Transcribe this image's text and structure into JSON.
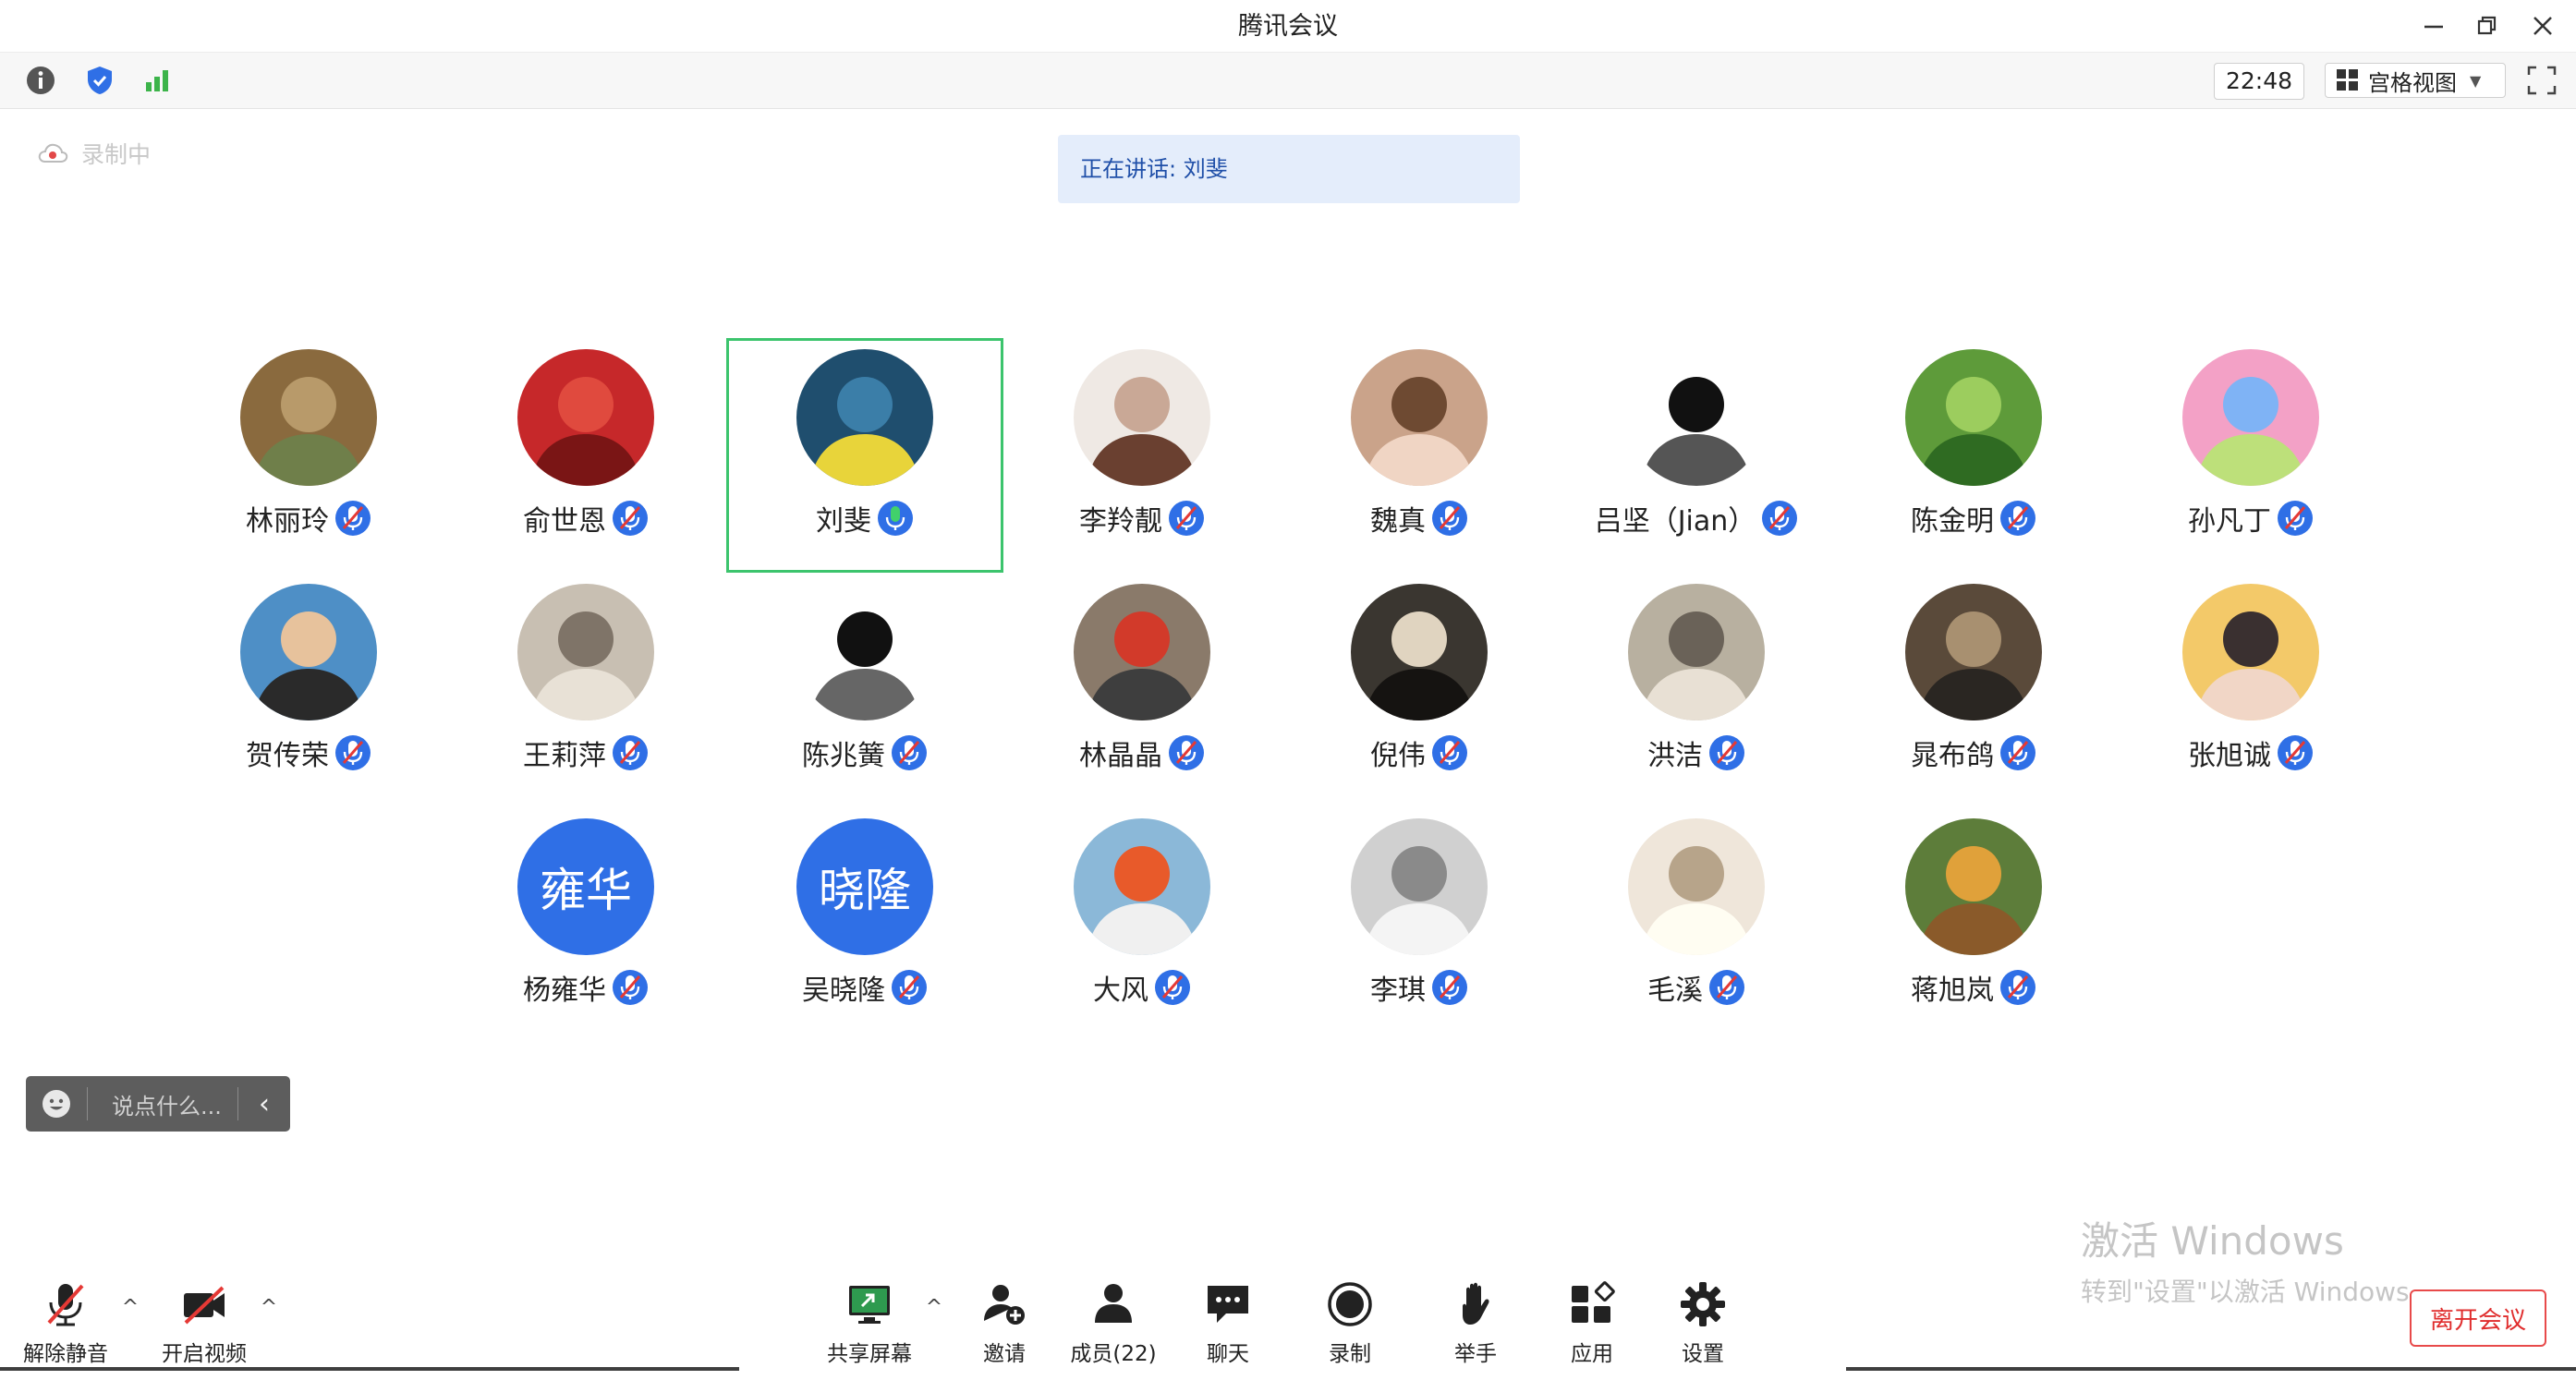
{
  "window": {
    "title": "腾讯会议"
  },
  "topbar": {
    "time": "22:48",
    "view_label": "宫格视图"
  },
  "recording": {
    "label": "录制中"
  },
  "speaking": {
    "label": "正在讲话: 刘斐"
  },
  "participants": [
    {
      "name": "林丽玲",
      "avatar_desc": "photo",
      "mic": "muted"
    },
    {
      "name": "俞世恩",
      "avatar_desc": "photo",
      "mic": "muted"
    },
    {
      "name": "刘斐",
      "avatar_desc": "photo",
      "mic": "active"
    },
    {
      "name": "李羚靓",
      "avatar_desc": "photo",
      "mic": "muted"
    },
    {
      "name": "魏真",
      "avatar_desc": "photo",
      "mic": "muted"
    },
    {
      "name": "吕坚（Jian）",
      "avatar_desc": "photo",
      "mic": "muted"
    },
    {
      "name": "陈金明",
      "avatar_desc": "photo",
      "mic": "muted"
    },
    {
      "name": "孙凡丁",
      "avatar_desc": "photo",
      "mic": "muted"
    },
    {
      "name": "贺传荣",
      "avatar_desc": "photo",
      "mic": "muted"
    },
    {
      "name": "王莉萍",
      "avatar_desc": "photo",
      "mic": "muted"
    },
    {
      "name": "陈兆簧",
      "avatar_desc": "photo",
      "mic": "muted"
    },
    {
      "name": "林晶晶",
      "avatar_desc": "photo",
      "mic": "muted"
    },
    {
      "name": "倪伟",
      "avatar_desc": "photo",
      "mic": "muted"
    },
    {
      "name": "洪洁",
      "avatar_desc": "photo",
      "mic": "muted"
    },
    {
      "name": "晁布鸽",
      "avatar_desc": "photo",
      "mic": "muted"
    },
    {
      "name": "张旭诚",
      "avatar_desc": "photo",
      "mic": "muted"
    },
    {
      "name": "杨雍华",
      "avatar_text": "雍华",
      "mic": "muted"
    },
    {
      "name": "吴晓隆",
      "avatar_text": "晓隆",
      "mic": "muted"
    },
    {
      "name": "大风",
      "avatar_desc": "photo",
      "mic": "muted"
    },
    {
      "name": "李琪",
      "avatar_desc": "photo",
      "mic": "muted"
    },
    {
      "name": "毛溪",
      "avatar_desc": "photo",
      "mic": "muted"
    },
    {
      "name": "蒋旭岚",
      "avatar_desc": "photo",
      "mic": "muted"
    }
  ],
  "chat": {
    "placeholder": "说点什么..."
  },
  "toolbar": {
    "unmute_label": "解除静音",
    "video_label": "开启视频",
    "share_label": "共享屏幕",
    "invite_label": "邀请",
    "members_label": "成员(22)",
    "chat_label": "聊天",
    "record_label": "录制",
    "raise_hand_label": "举手",
    "apps_label": "应用",
    "settings_label": "设置",
    "leave_label": "离开会议"
  },
  "watermark": {
    "line1": "激活 Windows",
    "line2": "转到\"设置\"以激活 Windows。"
  },
  "colors": {
    "accent_blue": "#2f6fe6",
    "active_green": "#3cc46d",
    "leave_red": "#e02d2d",
    "speaking_bg": "#e4edfb"
  }
}
